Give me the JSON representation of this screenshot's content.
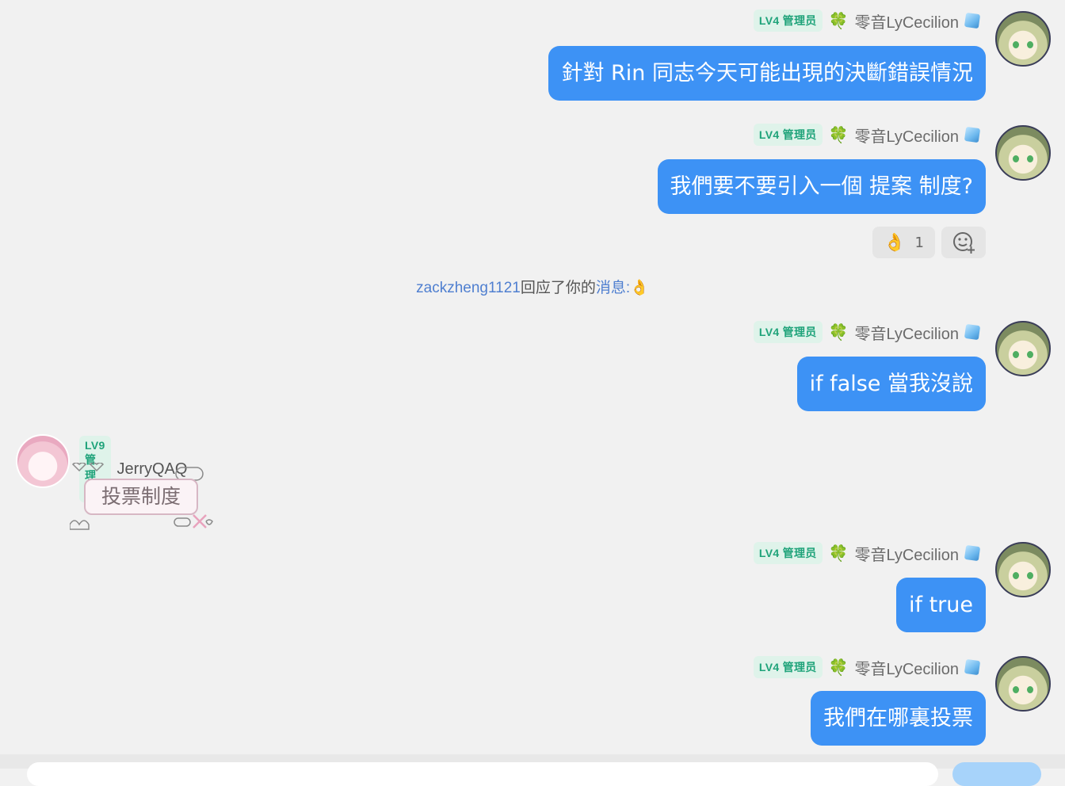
{
  "colors": {
    "background": "#f1f1f1",
    "bubble": "#3d92f5",
    "badge_bg": "#dff3ea",
    "badge_text": "#1fa37a",
    "link": "#4f7fd0"
  },
  "messages": [
    {
      "badge": "LV4 管理员",
      "sender": "零音LyCecilion",
      "text": "針對 Rin 同志今天可能出現的決斷錯誤情況"
    },
    {
      "badge": "LV4 管理员",
      "sender": "零音LyCecilion",
      "text": "我們要不要引入一個 提案 制度?"
    },
    {
      "badge": "LV4 管理员",
      "sender": "零音LyCecilion",
      "text": "if false 當我沒說"
    },
    {
      "badge": "LV4 管理员",
      "sender": "零音LyCecilion",
      "text": "if true"
    },
    {
      "badge": "LV4 管理员",
      "sender": "零音LyCecilion",
      "text": "我們在哪裏投票"
    }
  ],
  "reaction": {
    "emoji": "👌",
    "count": "1",
    "add_icon": "add-emoji-icon"
  },
  "notice": {
    "user": "zackzheng1121",
    "text": "回应了你的",
    "link": "消息:",
    "emoji": "👌"
  },
  "incoming": {
    "badge": "LV9 管理员",
    "sender": "JerryQAQ",
    "sticker_text": "投票制度"
  },
  "icons": {
    "clover": "🍀",
    "cube": "ice-cube-icon"
  }
}
